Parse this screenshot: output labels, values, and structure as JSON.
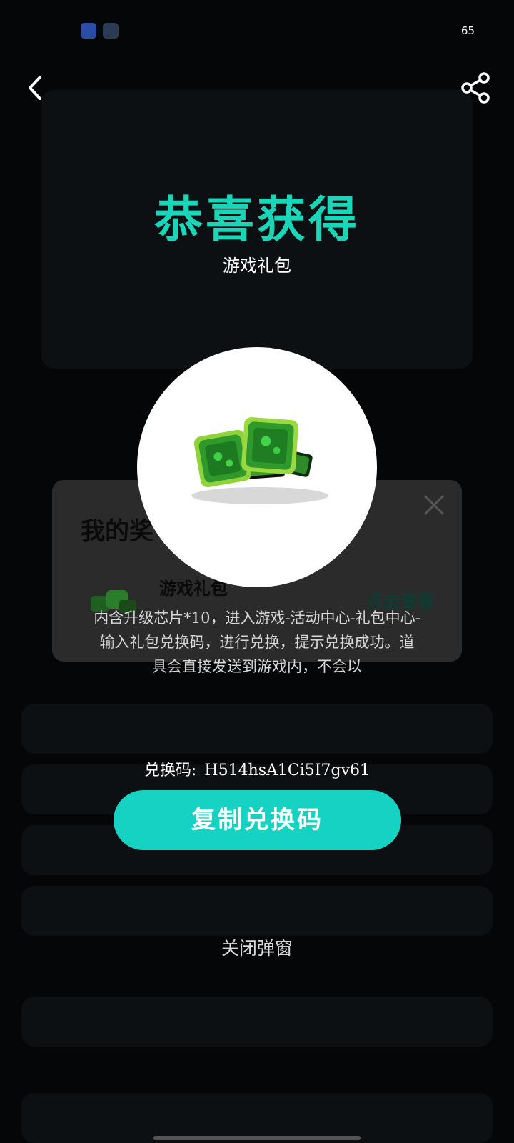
{
  "status_bar": {
    "battery": "65",
    "icons": [
      "app-icon-blue",
      "app-icon-dark"
    ]
  },
  "nav": {
    "back_icon": "chevron-left-icon",
    "share_icon": "share-icon"
  },
  "background_dialog": {
    "title": "我的奖",
    "gift_name": "游戏礼包",
    "view_link": "点击查看",
    "close_icon": "close-icon"
  },
  "popup": {
    "title": "恭喜获得",
    "subtitle": "游戏礼包",
    "description": "内含升级芯片*10，进入游戏-活动中心-礼包中心-输入礼包兑换码，进行兑换，提示兑换成功。道具会直接发送到游戏内，不会以",
    "code_label": "兑换码:",
    "code_value": "H514hsA1Ci5I7gv61",
    "copy_button": "复制兑换码",
    "close_text": "关闭弹窗"
  },
  "colors": {
    "accent": "#16d2c3",
    "title": "#19d6b8",
    "background": "#000000"
  }
}
